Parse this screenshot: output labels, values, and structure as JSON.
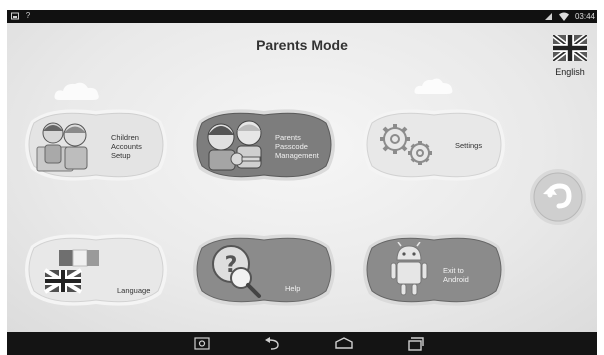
{
  "status_bar": {
    "time": "03:44",
    "icons_left": [
      "image-icon",
      "question-icon"
    ],
    "icons_right": [
      "signal-icon",
      "wifi-icon"
    ]
  },
  "header": {
    "title": "Parents Mode",
    "language_label": "English",
    "language_flag": "uk-flag-icon"
  },
  "tiles": {
    "children": {
      "label": "Children\nAccounts\nSetup",
      "style": "light",
      "art": "children-icon"
    },
    "passcode": {
      "label": "Parents\nPasscode\nManagement",
      "style": "dark",
      "art": "parents-key-icon"
    },
    "settings": {
      "label": "Settings",
      "style": "light",
      "art": "gears-icon"
    },
    "language": {
      "label": "Language",
      "style": "light",
      "art": "flags-icon"
    },
    "help": {
      "label": "Help",
      "style": "dark",
      "art": "help-magnifier-icon"
    },
    "exit": {
      "label": "Exit to\nAndroid",
      "style": "dark",
      "art": "android-robot-icon"
    }
  },
  "back_button": {
    "icon": "back-arrow-icon"
  },
  "navigation_bar": {
    "buttons": [
      "screenshot-icon",
      "back-icon",
      "home-icon",
      "recents-icon"
    ]
  },
  "colors": {
    "light_tile": "#e8e8e8",
    "dark_tile": "#8a8a8a",
    "background": "#e9e9e9",
    "back_button": "#c9c9c9"
  }
}
